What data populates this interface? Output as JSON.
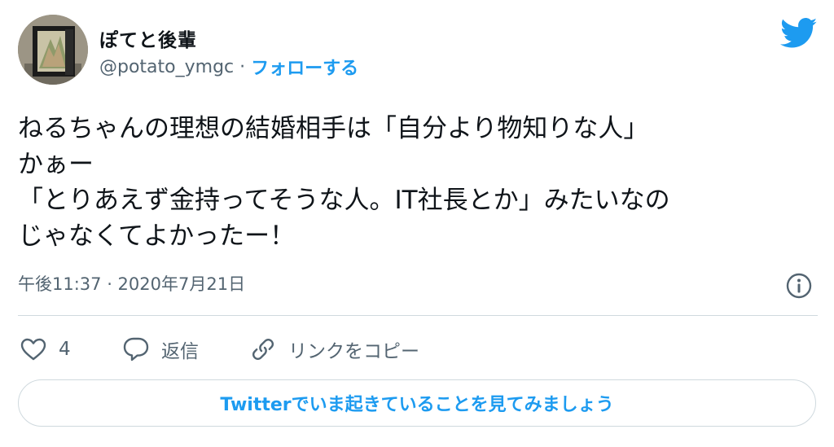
{
  "author": {
    "display_name": "ぽてと後輩",
    "handle": "@potato_ymgc",
    "separator": "·",
    "follow_label": "フォローする"
  },
  "tweet": {
    "lines": [
      "ねるちゃんの理想の結婚相手は「自分より物知りな人」",
      "かぁー",
      "「とりあえず金持ってそうな人。IT社長とか」みたいなの",
      "じゃなくてよかったー！"
    ],
    "timestamp": "午後11:37 · 2020年7月21日"
  },
  "actions": {
    "like_count": "4",
    "reply_label": "返信",
    "copy_link_label": "リンクをコピー"
  },
  "cta": {
    "label": "Twitterでいま起きていることを見てみましょう"
  },
  "colors": {
    "accent": "#1d9bf0",
    "secondary_text": "#536471",
    "border": "#cfd9de"
  },
  "icons": {
    "logo": "twitter-bird-icon",
    "info": "info-icon",
    "like": "heart-icon",
    "reply": "speech-bubble-icon",
    "copy_link": "link-icon"
  }
}
